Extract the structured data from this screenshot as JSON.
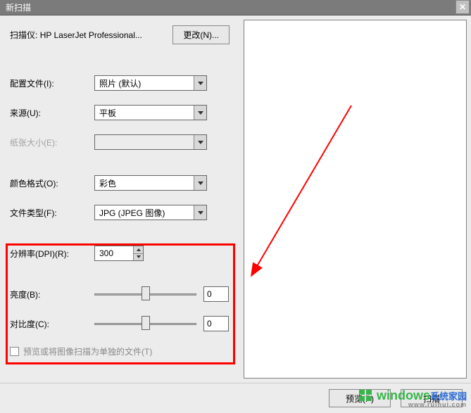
{
  "title": "新扫描",
  "scanner": {
    "label": "扫描仪:",
    "name": "HP LaserJet Professional...",
    "change_btn": "更改(N)..."
  },
  "profile": {
    "label": "配置文件(I):",
    "value": "照片 (默认)"
  },
  "source": {
    "label": "来源(U):",
    "value": "平板"
  },
  "papersize": {
    "label": "纸张大小(E):",
    "value": ""
  },
  "colorformat": {
    "label": "颜色格式(O):",
    "value": "彩色"
  },
  "filetype": {
    "label": "文件类型(F):",
    "value": "JPG (JPEG 图像)"
  },
  "resolution": {
    "label": "分辨率(DPI)(R):",
    "value": "300"
  },
  "brightness": {
    "label": "亮度(B):",
    "value": "0"
  },
  "contrast": {
    "label": "对比度(C):",
    "value": "0"
  },
  "preview_checkbox": "预览或将图像扫描为单独的文件(T)",
  "buttons": {
    "preview": "预览(P)",
    "scan": "扫描"
  },
  "watermark": {
    "brand1": "windows",
    "brand2": "系统家园",
    "sub": "www.ruihui.com"
  }
}
